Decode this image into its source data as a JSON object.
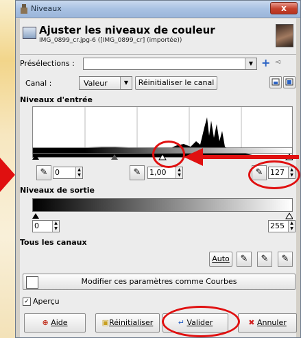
{
  "window": {
    "title": "Niveaux",
    "close_label": "x"
  },
  "header": {
    "title": "Ajuster les niveaux de couleur",
    "subtitle": "IMG_0899_cr.jpg-6 ([IMG_0899_cr] (importée))"
  },
  "presets": {
    "label": "Présélections :",
    "value": ""
  },
  "channel": {
    "label": "Canal :",
    "value": "Valeur",
    "reset_label": "Réinitialiser le canal"
  },
  "input_levels": {
    "section_title": "Niveaux d'entrée",
    "black_value": "0",
    "gamma_value": "1,00",
    "white_value": "127"
  },
  "output_levels": {
    "section_title": "Niveaux de sortie",
    "low_value": "0",
    "high_value": "255"
  },
  "all_channels": {
    "section_title": "Tous les canaux",
    "auto_label": "Auto"
  },
  "curves_button_label": "Modifier ces paramètres comme Courbes",
  "preview": {
    "label": "Aperçu",
    "checked": true
  },
  "footer": {
    "help_label": "Aide",
    "reset_label": "Réinitialiser",
    "ok_label": "Valider",
    "cancel_label": "Annuler"
  },
  "colors": {
    "annotation": "#e01010",
    "title_bar": "#a9c2e3"
  }
}
